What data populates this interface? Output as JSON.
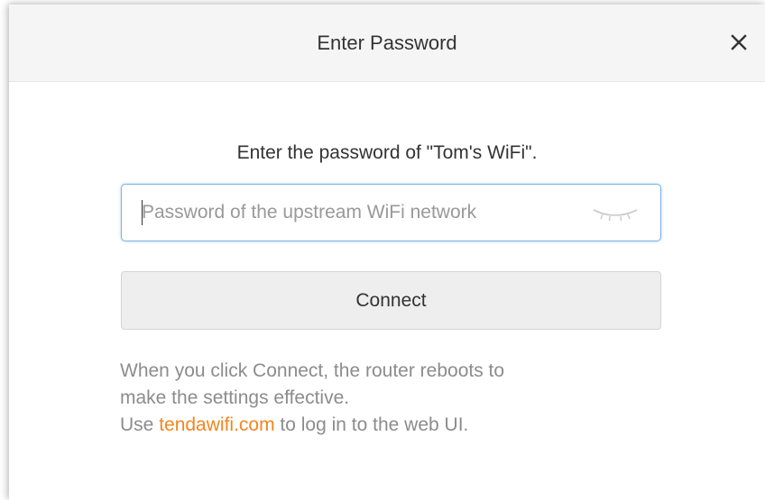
{
  "dialog": {
    "title": "Enter Password",
    "close_icon": "close-icon"
  },
  "prompt": "Enter the password of \"Tom's WiFi\".",
  "password": {
    "placeholder": "Password of the upstream WiFi network",
    "value": "",
    "toggle_icon": "eye-closed-icon"
  },
  "connect_label": "Connect",
  "note": {
    "line1": "When you click Connect, the router reboots to",
    "line2": "make the settings effective.",
    "line3_prefix": "Use ",
    "link": "tendawifi.com",
    "line3_suffix": " to log in to the web UI."
  },
  "colors": {
    "link": "#f2851e",
    "focus_border": "#7ab0e8",
    "header_bg": "#f5f5f5"
  }
}
